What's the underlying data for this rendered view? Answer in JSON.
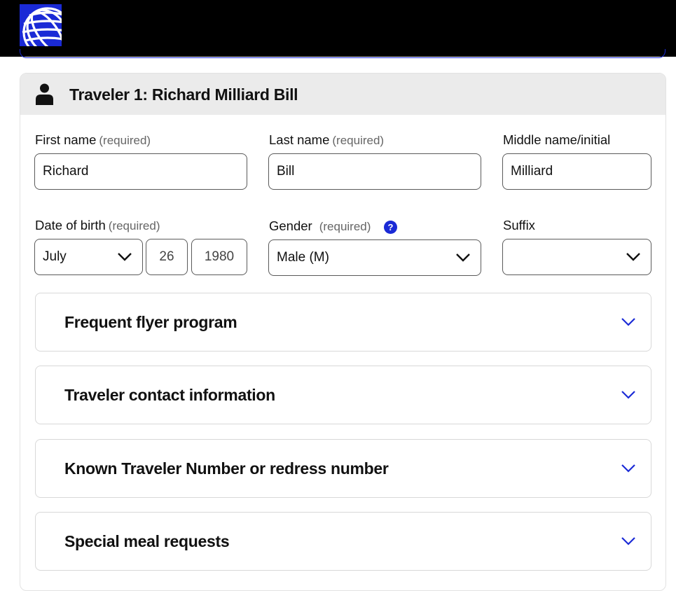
{
  "brand": {
    "logo_icon": "globe-logo-icon",
    "accent_color": "#1a2ad6"
  },
  "traveler": {
    "title": "Traveler 1: Richard Milliard Bill",
    "person_icon": "person-icon",
    "first_name": {
      "label": "First name",
      "required": "(required)",
      "value": "Richard"
    },
    "last_name": {
      "label": "Last name",
      "required": "(required)",
      "value": "Bill"
    },
    "middle_name": {
      "label": "Middle name/initial",
      "value": "Milliard"
    },
    "dob": {
      "label": "Date of birth",
      "required": "(required)",
      "month": "July",
      "day": "26",
      "year": "1980"
    },
    "gender": {
      "label": "Gender",
      "required": "(required)",
      "help": "?",
      "value": "Male (M)"
    },
    "suffix": {
      "label": "Suffix",
      "value": ""
    }
  },
  "sections": [
    {
      "label": "Frequent flyer program"
    },
    {
      "label": "Traveler contact information"
    },
    {
      "label": "Known Traveler Number or redress number"
    },
    {
      "label": "Special meal requests"
    }
  ]
}
